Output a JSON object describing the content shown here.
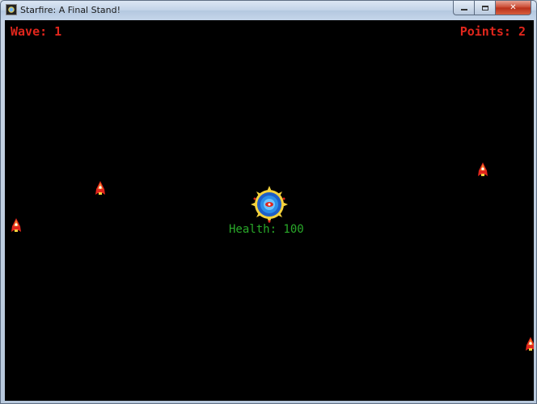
{
  "window": {
    "title": "Starfire: A Final Stand!",
    "minimize_label": "",
    "maximize_label": "",
    "close_label": "✕"
  },
  "hud": {
    "wave_text": "Wave: 1",
    "points_text": "Points: 2",
    "health_text": "Health: 100"
  },
  "colors": {
    "hud_red": "#e0261c",
    "health_green": "#29a829",
    "background": "#000000"
  },
  "sprites": {
    "player": "space-station-icon",
    "enemy": "enemy-ship-icon",
    "enemy_count": 4
  }
}
